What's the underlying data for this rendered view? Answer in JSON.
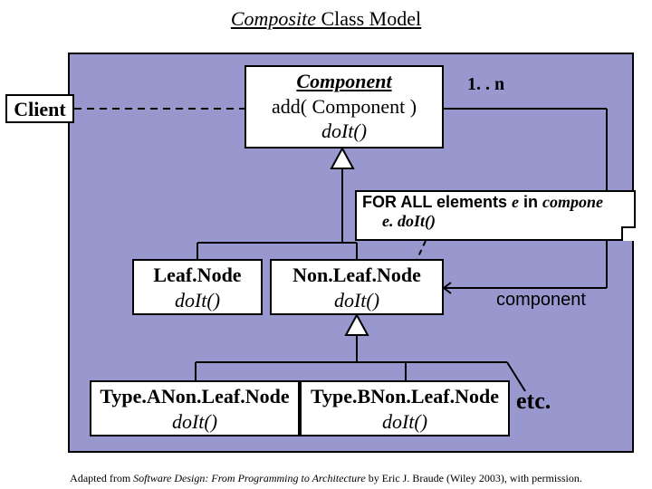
{
  "title_italic": "Composite",
  "title_rest": " Class Model",
  "client": {
    "label": "Client"
  },
  "component": {
    "name": "Component",
    "op1": "add( Component )",
    "op2": "doIt()"
  },
  "multiplicity": "1. . n",
  "note": {
    "line1_prefix": "FOR ALL elements ",
    "line1_var": "e",
    "line1_suffix": " in ",
    "line1_ital": "compone",
    "line2": "e. doIt()"
  },
  "leaf": {
    "name": "Leaf.Node",
    "op": "doIt()"
  },
  "nonleaf": {
    "name": "Non.Leaf.Node",
    "op": "doIt()"
  },
  "assoc_label": "component",
  "typea": {
    "name": "Type.ANon.Leaf.Node",
    "op": "doIt()"
  },
  "typeb": {
    "name": "Type.BNon.Leaf.Node",
    "op": "doIt()"
  },
  "etc": "etc.",
  "credit_prefix": "Adapted from ",
  "credit_book": "Software Design: From Programming to Architecture",
  "credit_suffix": " by Eric J. Braude (Wiley 2003), with permission."
}
